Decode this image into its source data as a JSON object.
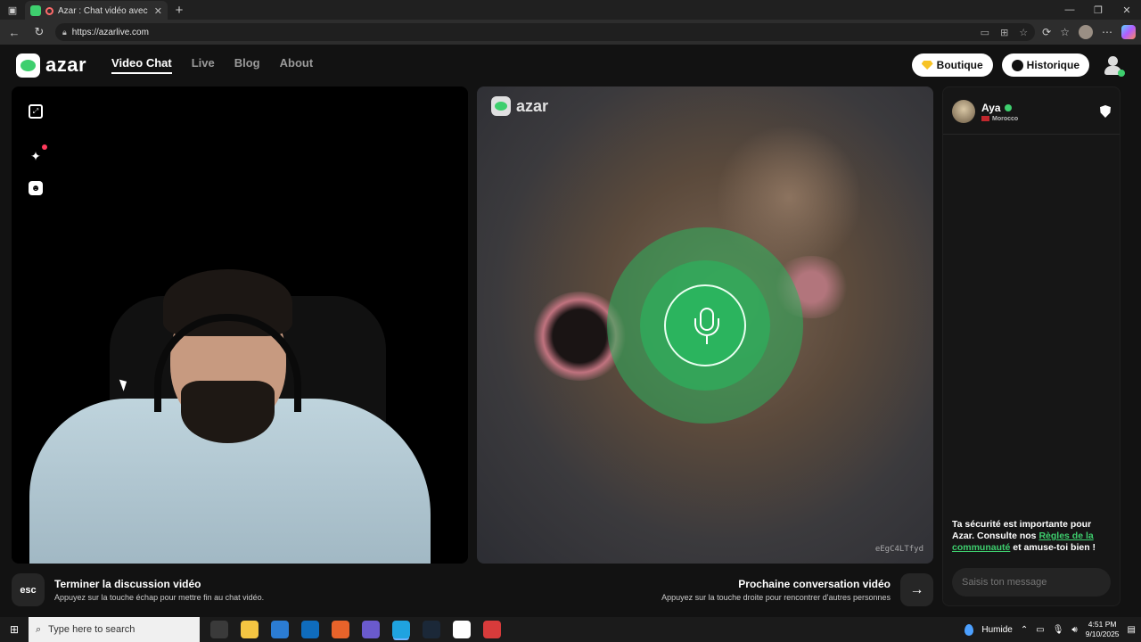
{
  "browser": {
    "tab_title": "Azar : Chat vidéo avec de no",
    "tab_close": "✕",
    "new_tab": "+",
    "url": "https://azarlive.com",
    "window_controls": [
      "—",
      "❐",
      "✕"
    ]
  },
  "site": {
    "logo_text": "azar",
    "nav": [
      {
        "label": "Video Chat",
        "active": true
      },
      {
        "label": "Live",
        "active": false
      },
      {
        "label": "Blog",
        "active": false
      },
      {
        "label": "About",
        "active": false
      }
    ],
    "boutique_label": "Boutique",
    "historique_label": "Historique"
  },
  "left_panel": {
    "icons": [
      "expand-icon",
      "sparkle-effects-icon",
      "face-filter-icon"
    ]
  },
  "middle_panel": {
    "watermark_logo": "azar",
    "session_code": "eEgC4LTfyd"
  },
  "chat": {
    "peer_name": "Aya",
    "peer_country": "Morocco",
    "safety_text_1": "Ta sécurité est importante pour Azar. Consulte nos ",
    "safety_link": "Règles de la communauté",
    "safety_text_2": " et amuse-toi bien !",
    "message_placeholder": "Saisis ton message"
  },
  "controls": {
    "esc_key": "esc",
    "end_title": "Terminer la discussion vidéo",
    "end_subtitle": "Appuyez sur la touche échap pour mettre fin au chat vidéo.",
    "next_title": "Prochaine conversation vidéo",
    "next_subtitle": "Appuyez sur la touche droite pour rencontrer d'autres personnes",
    "next_arrow": "→"
  },
  "taskbar": {
    "search_placeholder": "Type here to search",
    "weather": "Humide",
    "time": "4:51 PM",
    "date": "9/10/2025",
    "app_colors": [
      "#3a3a3a",
      "#f4c542",
      "#2b7cd3",
      "#0f6cbd",
      "#e8632a",
      "#6a5acd",
      "#1fa3e0",
      "#1b2838",
      "#ffffff",
      "#d83b3b"
    ]
  }
}
